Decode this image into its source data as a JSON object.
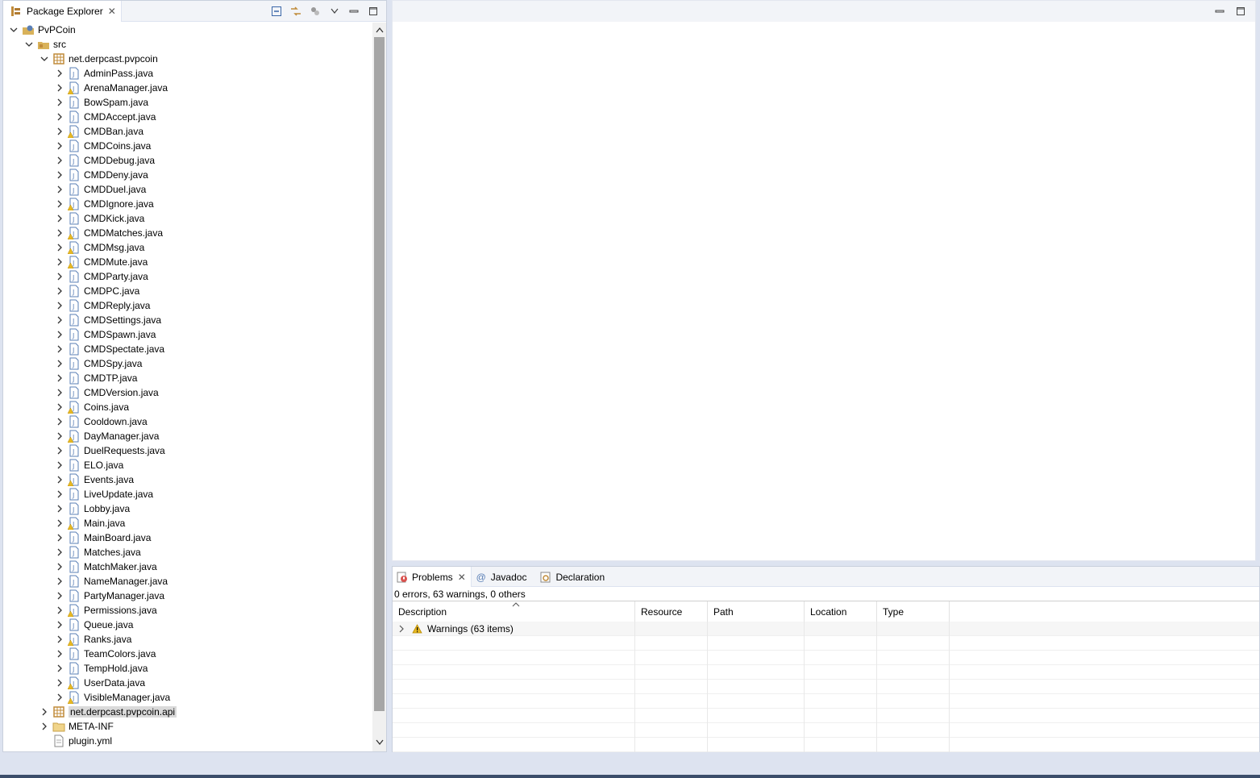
{
  "package_explorer": {
    "title": "Package Explorer",
    "icons": [
      "collapse-all-icon",
      "link-with-editor-icon",
      "filters-icon",
      "view-menu-icon",
      "minimize-icon",
      "maximize-icon"
    ],
    "project": "PvPCoin",
    "src": "src",
    "package": "net.derpcast.pvpcoin",
    "files": [
      "AdminPass.java",
      "ArenaManager.java",
      "BowSpam.java",
      "CMDAccept.java",
      "CMDBan.java",
      "CMDCoins.java",
      "CMDDebug.java",
      "CMDDeny.java",
      "CMDDuel.java",
      "CMDIgnore.java",
      "CMDKick.java",
      "CMDMatches.java",
      "CMDMsg.java",
      "CMDMute.java",
      "CMDParty.java",
      "CMDPC.java",
      "CMDReply.java",
      "CMDSettings.java",
      "CMDSpawn.java",
      "CMDSpectate.java",
      "CMDSpy.java",
      "CMDTP.java",
      "CMDVersion.java",
      "Coins.java",
      "Cooldown.java",
      "DayManager.java",
      "DuelRequests.java",
      "ELO.java",
      "Events.java",
      "LiveUpdate.java",
      "Lobby.java",
      "Main.java",
      "MainBoard.java",
      "Matches.java",
      "MatchMaker.java",
      "NameManager.java",
      "PartyManager.java",
      "Permissions.java",
      "Queue.java",
      "Ranks.java",
      "TeamColors.java",
      "TempHold.java",
      "UserData.java",
      "VisibleManager.java"
    ],
    "warned_files": [
      1,
      4,
      9,
      11,
      12,
      13,
      23,
      25,
      28,
      31,
      37,
      39,
      42,
      43
    ],
    "api_package": "net.derpcast.pvpcoin.api",
    "meta_inf": "META-INF",
    "plugin_yml": "plugin.yml"
  },
  "problems": {
    "tabs": [
      "Problems",
      "Javadoc",
      "Declaration"
    ],
    "summary": "0 errors, 63 warnings, 0 others",
    "columns": [
      "Description",
      "Resource",
      "Path",
      "Location",
      "Type"
    ],
    "warnings_group": "Warnings (63 items)"
  },
  "colors": {
    "warning": "#e8b923",
    "java_file": "#5a7fb5",
    "package": "#c08b3a",
    "folder": "#d9b25a"
  }
}
